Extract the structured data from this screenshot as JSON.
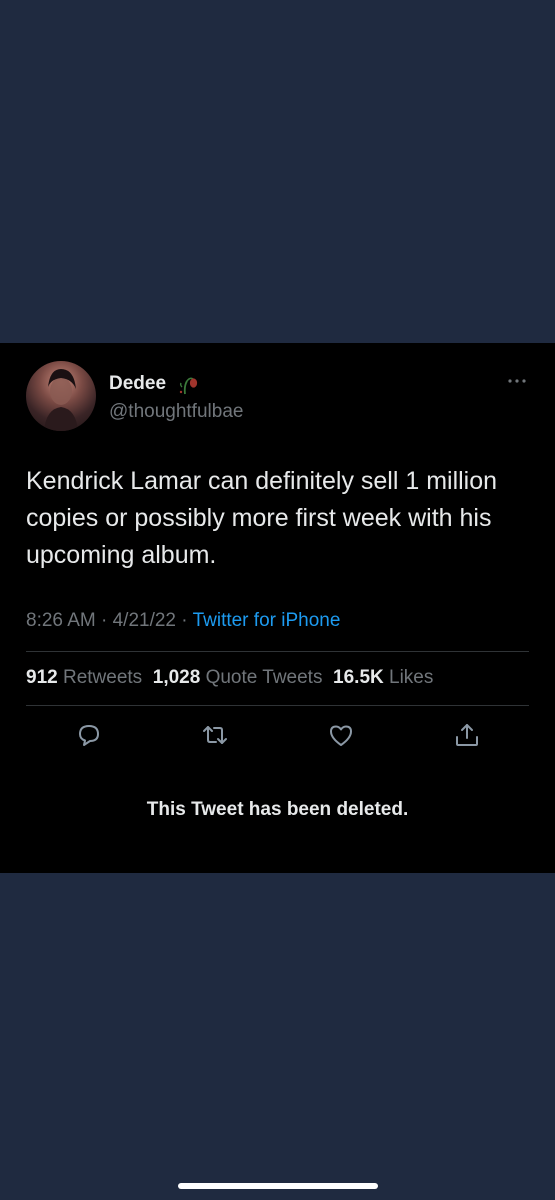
{
  "tweet": {
    "display_name": "Dedee",
    "name_emoji": "wilted-rose-emoji",
    "handle": "@thoughtfulbae",
    "text": "Kendrick Lamar can definitely sell 1 million copies or possibly more first week with his upcoming album.",
    "time": "8:26 AM",
    "date": "4/21/22",
    "separator": " · ",
    "source": "Twitter for iPhone",
    "stats": {
      "retweets_count": "912",
      "retweets_label": "Retweets",
      "quotes_count": "1,028",
      "quotes_label": "Quote Tweets",
      "likes_count": "16.5K",
      "likes_label": "Likes"
    },
    "actions": [
      "reply-icon",
      "retweet-icon",
      "like-icon",
      "share-icon"
    ],
    "deleted_notice": "This Tweet has been deleted."
  },
  "colors": {
    "page_background": "#1f2a40",
    "card_background": "#000000",
    "primary_text": "#e7e9ea",
    "secondary_text": "#71767b",
    "link": "#1d9bf0",
    "divider": "#2f3336"
  }
}
